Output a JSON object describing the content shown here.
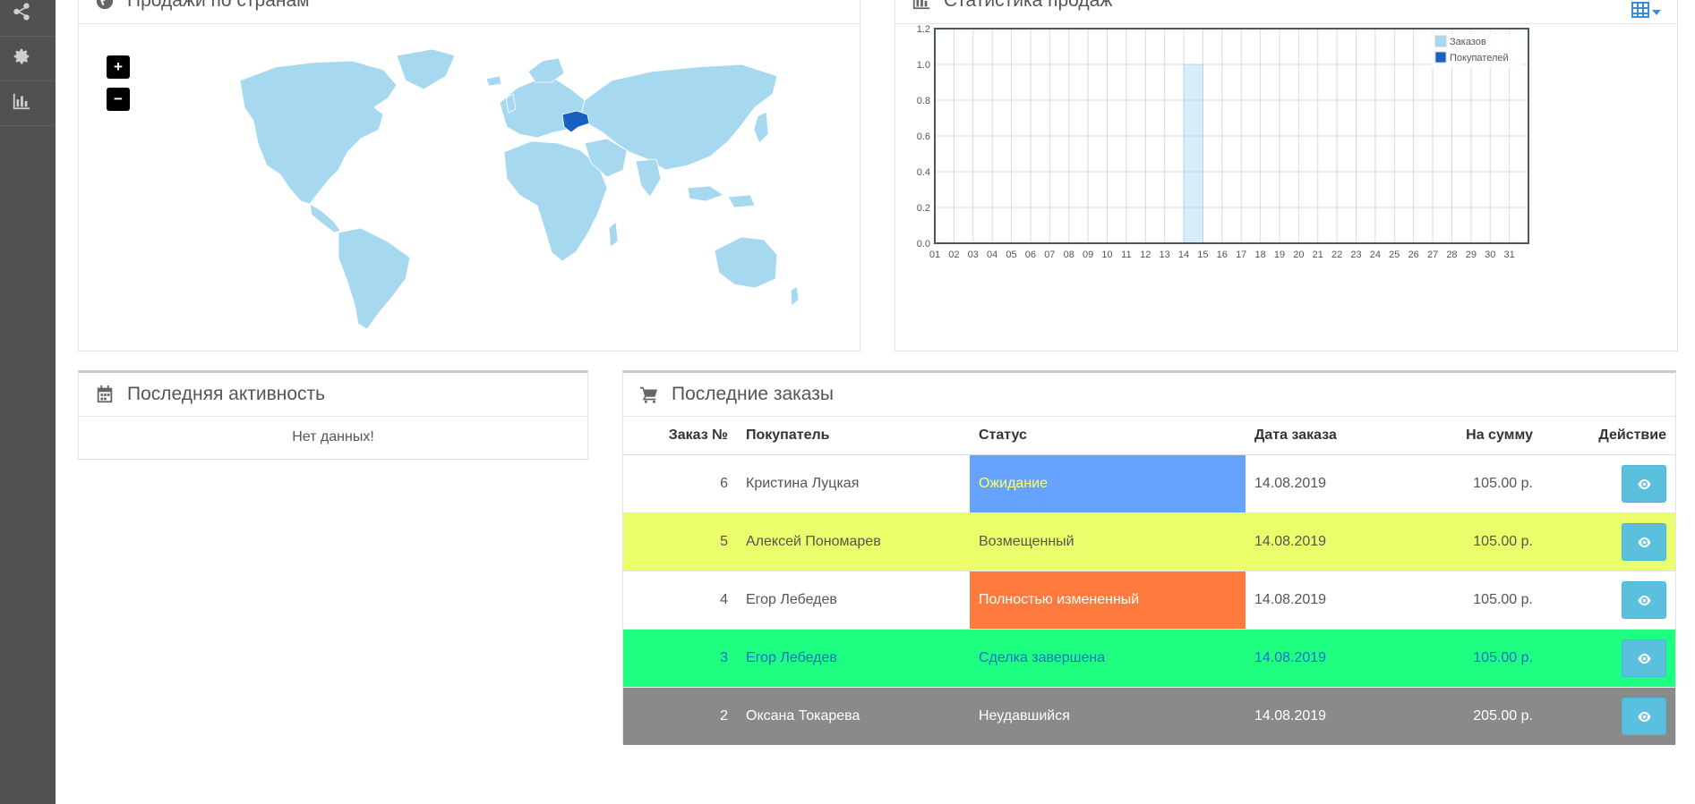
{
  "sidebar": {
    "items": [
      {
        "icon": "share-icon"
      },
      {
        "icon": "gear-icon"
      },
      {
        "icon": "bar-chart-icon"
      }
    ]
  },
  "map_panel": {
    "title": "Продажи по странам",
    "icon": "globe-icon",
    "zoom_in": "+",
    "zoom_out": "−",
    "highlighted_country": "Ukraine",
    "colors": {
      "land": "#a6d8f0",
      "highlight": "#1a5fc2"
    }
  },
  "stats_panel": {
    "title": "Статистика продаж",
    "icon": "bar-chart-icon"
  },
  "chart_data": {
    "type": "bar",
    "categories": [
      "01",
      "02",
      "03",
      "04",
      "05",
      "06",
      "07",
      "08",
      "09",
      "10",
      "11",
      "12",
      "13",
      "14",
      "15",
      "16",
      "17",
      "18",
      "19",
      "20",
      "21",
      "22",
      "23",
      "24",
      "25",
      "26",
      "27",
      "28",
      "29",
      "30",
      "31"
    ],
    "series": [
      {
        "name": "Заказов",
        "color": "#a6d8f0",
        "values": [
          0,
          0,
          0,
          0,
          0,
          0,
          0,
          0,
          0,
          0,
          0,
          0,
          0,
          1,
          0,
          0,
          0,
          0,
          0,
          0,
          0,
          0,
          0,
          0,
          0,
          0,
          0,
          0,
          0,
          0,
          0
        ]
      },
      {
        "name": "Покупателей",
        "color": "#1a5fc2",
        "values": [
          0,
          0,
          0,
          0,
          0,
          0,
          0,
          0,
          0,
          0,
          0,
          0,
          0,
          0,
          0,
          0,
          0,
          0,
          0,
          0,
          0,
          0,
          0,
          0,
          0,
          0,
          0,
          0,
          0,
          0,
          0
        ]
      }
    ],
    "yticks": [
      "0.0",
      "0.2",
      "0.4",
      "0.6",
      "0.8",
      "1.0",
      "1.2"
    ],
    "ylim": [
      0,
      1.2
    ],
    "grid": true,
    "legend": "top-right"
  },
  "activity_panel": {
    "title": "Последняя активность",
    "icon": "calendar-icon",
    "empty": "Нет данных!"
  },
  "orders_panel": {
    "title": "Последние заказы",
    "icon": "cart-icon",
    "columns": [
      "Заказ №",
      "Покупатель",
      "Статус",
      "Дата заказа",
      "На сумму",
      "Действие"
    ],
    "rows": [
      {
        "id": "6",
        "customer": "Кристина Луцкая",
        "status": "Ожидание",
        "date": "14.08.2019",
        "total": "105.00 р.",
        "row_bg": "#ffffff",
        "row_fg": "#555555",
        "status_bg": "#66a3ff",
        "status_fg": "#ffff66"
      },
      {
        "id": "5",
        "customer": "Алексей Пономарев",
        "status": "Возмещенный",
        "date": "14.08.2019",
        "total": "105.00 р.",
        "row_bg": "#ecfd6c",
        "row_fg": "#555555",
        "status_bg": "#ecfd6c",
        "status_fg": "#555555"
      },
      {
        "id": "4",
        "customer": "Егор Лебедев",
        "status": "Полностью измененный",
        "date": "14.08.2019",
        "total": "105.00 р.",
        "row_bg": "#ffffff",
        "row_fg": "#555555",
        "status_bg": "#ff7a3c",
        "status_fg": "#ffffff"
      },
      {
        "id": "3",
        "customer": "Егор Лебедев",
        "status": "Сделка завершена",
        "date": "14.08.2019",
        "total": "105.00 р.",
        "row_bg": "#1eff82",
        "row_fg": "#1f6fd0",
        "status_bg": "#1eff82",
        "status_fg": "#1f6fd0"
      },
      {
        "id": "2",
        "customer": "Оксана Токарева",
        "status": "Неудавшийся",
        "date": "14.08.2019",
        "total": "205.00 р.",
        "row_bg": "#8a8a8a",
        "row_fg": "#ffffff",
        "status_bg": "#8a8a8a",
        "status_fg": "#ffffff"
      }
    ],
    "action_icon": "eye-icon"
  }
}
